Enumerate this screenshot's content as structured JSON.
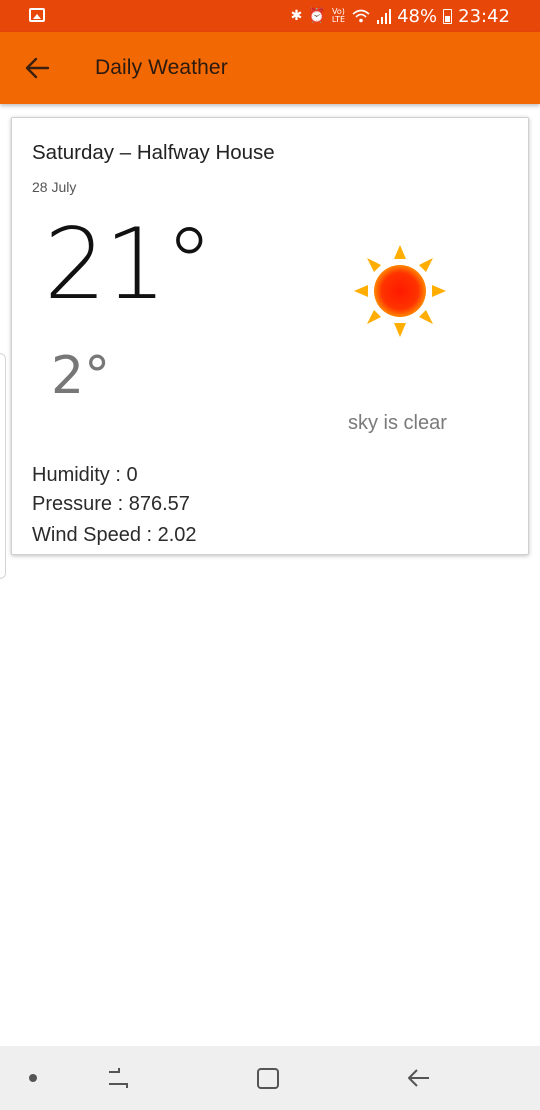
{
  "status_bar": {
    "battery": "48%",
    "time": "23:42",
    "volte_top": "Vo)",
    "volte_bottom": "LTE"
  },
  "app_bar": {
    "title": "Daily Weather"
  },
  "weather": {
    "day_place": "Saturday – Halfway House",
    "date": "28 July",
    "temp_max": "21°",
    "temp_min": "2°",
    "description": "sky is clear",
    "humidity": "Humidity : 0",
    "pressure": "Pressure : 876.57",
    "wind_speed": "Wind Speed : 2.02"
  },
  "icons": {
    "status_left": "gallery-icon",
    "status_right": [
      "bluetooth-icon",
      "alarm-icon",
      "volte-icon",
      "wifi-icon",
      "signal-icon",
      "battery-icon"
    ],
    "weather": "sun-icon",
    "nav": [
      "recent-apps-icon",
      "home-icon",
      "back-icon"
    ]
  },
  "colors": {
    "status_bar": "#e8470a",
    "app_bar": "#f26904",
    "sun": "#ff2a00",
    "sun_rays": "#ffb300"
  }
}
